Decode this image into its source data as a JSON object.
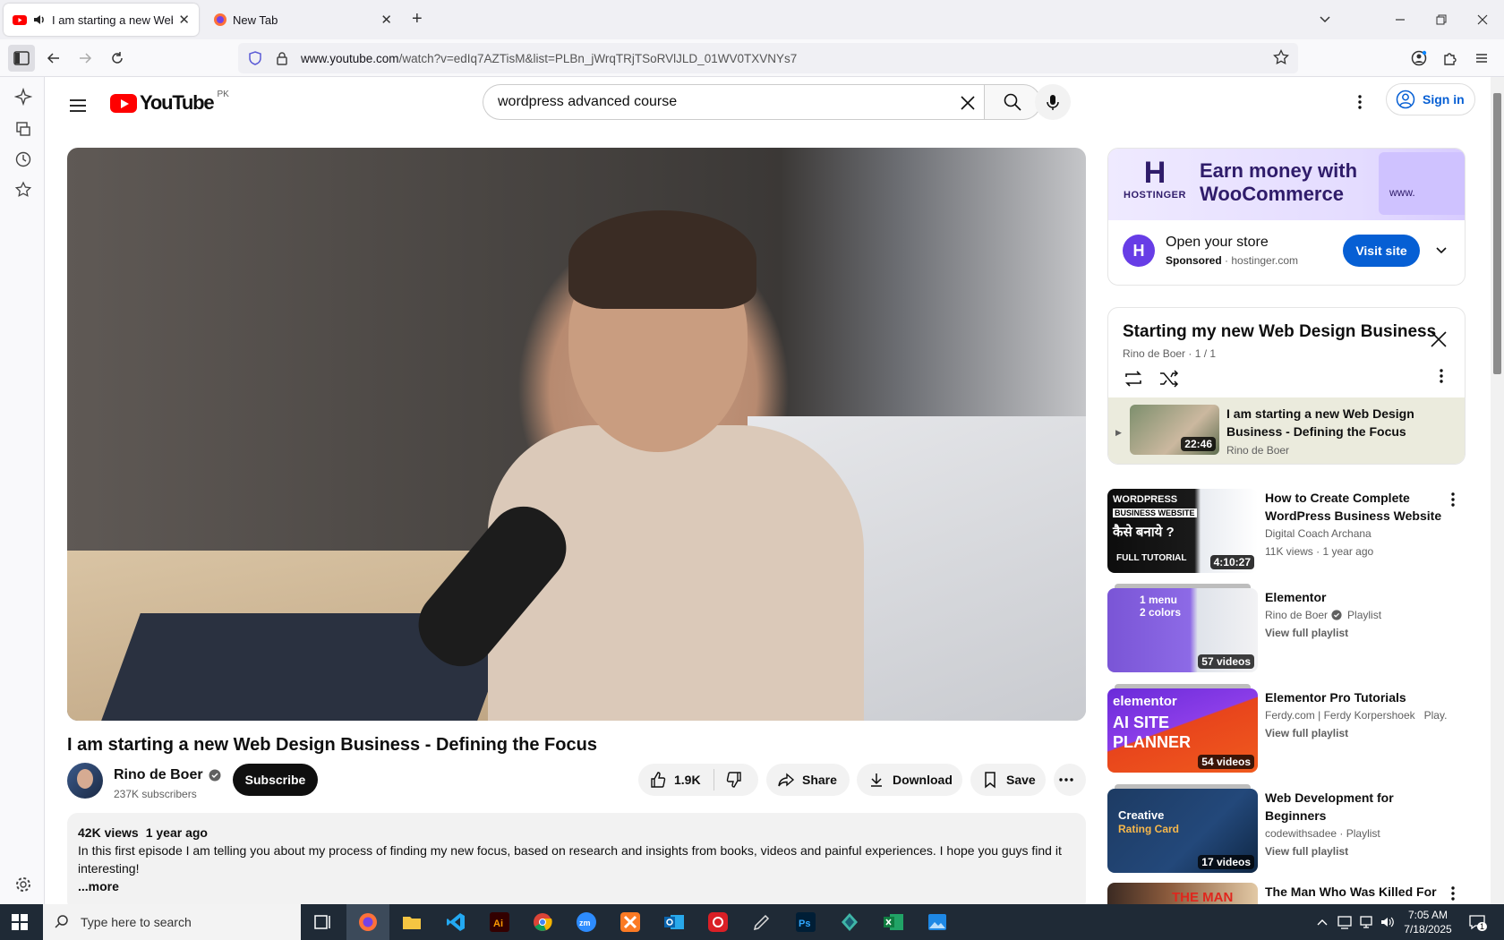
{
  "browser": {
    "tabs": [
      {
        "title": "I am starting a new Web Design Business - Defining the Focus",
        "close": "✕"
      },
      {
        "title": "New Tab",
        "close": "✕"
      }
    ],
    "new_tab": "+",
    "url_host": "www.youtube.com",
    "url_path": "/watch?v=edIq7AZTisM&list=PLBn_jWrqTRjTSoRVlJLD_01WV0TXVNYs7"
  },
  "masthead": {
    "logo_text": "YouTube",
    "country": "PK",
    "search_value": "wordpress advanced course",
    "sign_in": "Sign in"
  },
  "video": {
    "title": "I am starting a new Web Design Business - Defining the Focus",
    "channel": "Rino de Boer",
    "subscribers": "237K subscribers",
    "subscribe_label": "Subscribe",
    "likes": "1.9K",
    "share_label": "Share",
    "download_label": "Download",
    "save_label": "Save",
    "views": "42K views",
    "age": "1 year ago",
    "description": "In this first episode I am telling you about my process of finding my new focus, based on research and insights from books, videos and painful experiences. I hope you guys find it interesting!",
    "more": "...more"
  },
  "ad": {
    "brand": "HOSTINGER",
    "headline_1": "Earn money with",
    "headline_2": "WooCommerce",
    "www": "www.",
    "title": "Open your store",
    "sponsored": "Sponsored",
    "domain": "hostinger.com",
    "visit_label": "Visit site"
  },
  "playlist": {
    "title": "Starting my new Web Design Business",
    "meta": "Rino de Boer · 1 / 1",
    "item_title": "I am starting a new Web Design Business - Defining the Focus",
    "item_channel": "Rino de Boer",
    "item_duration": "22:46"
  },
  "recommendations": [
    {
      "title": "How to Create Complete WordPress Business Website ...",
      "channel": "Digital Coach Archana",
      "meta": "11K views · 1 year ago",
      "badge": "4:10:27",
      "thumb_text_1": "WORDPRESS",
      "thumb_text_2": "BUSINESS WEBSITE",
      "thumb_text_3": "कैसे बनाये ?",
      "thumb_text_4": "FULL TUTORIAL"
    },
    {
      "title": "Elementor",
      "channel": "Rino de Boer",
      "meta": "Playlist",
      "playlist_link": "View full playlist",
      "badge": "57 videos",
      "thumb_text_1": "1 menu",
      "thumb_text_2": "2 colors"
    },
    {
      "title": "Elementor Pro Tutorials",
      "channel": "Ferdy.com | Ferdy Korpershoek",
      "meta": "Play...",
      "playlist_link": "View full playlist",
      "badge": "54 videos",
      "thumb_text_1": "elementor",
      "thumb_text_2": "AI SITE",
      "thumb_text_3": "PLANNER"
    },
    {
      "title": "Web Development for Beginners",
      "channel": "codewithsadee",
      "meta": "Playlist",
      "playlist_link": "View full playlist",
      "badge": "17 videos",
      "thumb_text_1": "Creative",
      "thumb_text_2": "Rating Card"
    },
    {
      "title": "The Man Who Was Killed For",
      "thumb_text_1": "THE MAN"
    }
  ],
  "taskbar": {
    "search_placeholder": "Type here to search",
    "time": "7:05 AM",
    "date": "7/18/2025",
    "notification_count": "1"
  }
}
